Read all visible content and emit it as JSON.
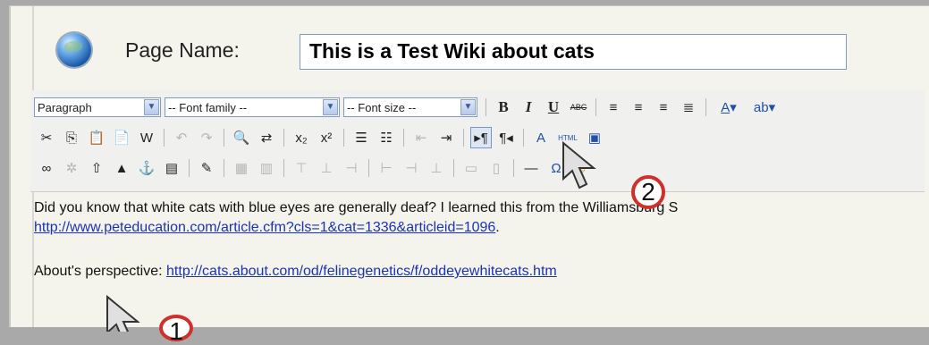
{
  "page_name": {
    "label": "Page Name:",
    "value": "This is a Test Wiki about cats"
  },
  "toolbar": {
    "format_select": "Paragraph",
    "font_family_select": "-- Font family --",
    "font_size_select": "-- Font size --",
    "bold": "B",
    "italic": "I",
    "underline": "U",
    "strikethrough": "ABC",
    "html_button": "HTML",
    "omega": "Ω"
  },
  "content": {
    "line1": "Did you know that white cats with blue eyes are generally deaf? I learned this from the Williamsburg S",
    "link1": "http://www.peteducation.com/article.cfm?cls=1&cat=1336&articleid=1096",
    "line2_suffix": ".",
    "line3_prefix": "About's perspective: ",
    "link2": "http://cats.about.com/od/felinegenetics/f/oddeyewhitecats.htm"
  },
  "callouts": {
    "one": "1",
    "two": "2"
  },
  "colors": {
    "background": "#a9a9a9",
    "panel": "#f4f4ec",
    "callout_border": "#d0302b",
    "link": "#1a33b5"
  }
}
